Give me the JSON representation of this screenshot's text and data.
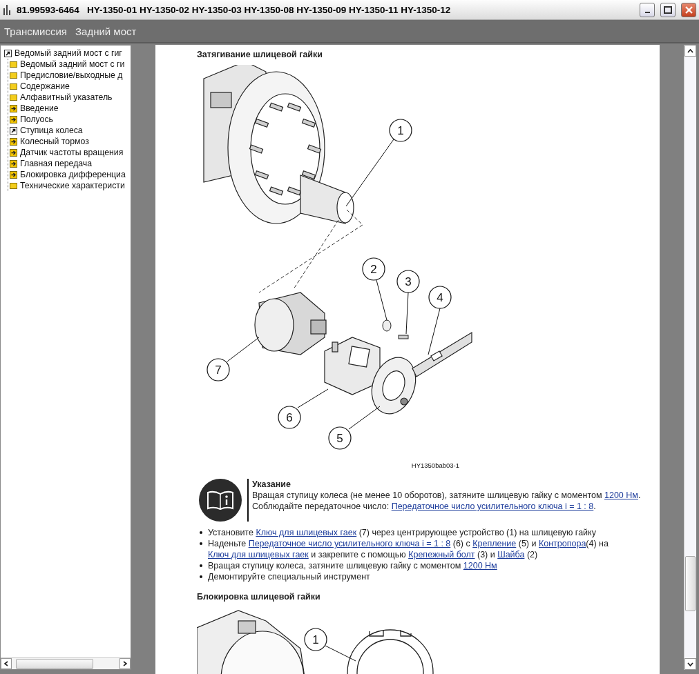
{
  "window": {
    "title": "81.99593-6464   HY-1350-01 HY-1350-02 HY-1350-03 HY-1350-08 HY-1350-09 HY-1350-11 HY-1350-12"
  },
  "menu": [
    {
      "label": "Трансмиссия"
    },
    {
      "label": "Задний мост"
    }
  ],
  "toc": {
    "items": [
      {
        "label": "Ведомый задний мост с гиг",
        "kind": "open",
        "expanded": true,
        "children": [
          {
            "label": "Ведомый задний мост с ги",
            "kind": "page"
          },
          {
            "label": "Предисловие/выходные д",
            "kind": "page"
          },
          {
            "label": "Содержание",
            "kind": "page"
          },
          {
            "label": "Алфавитный указатель",
            "kind": "page"
          },
          {
            "label": "Введение",
            "kind": "chapter"
          },
          {
            "label": "Полуось",
            "kind": "chapter"
          },
          {
            "label": "Ступица колеса",
            "kind": "open"
          },
          {
            "label": "Колесный тормоз",
            "kind": "chapter"
          },
          {
            "label": "Датчик частоты вращения",
            "kind": "chapter"
          },
          {
            "label": "Главная передача",
            "kind": "chapter"
          },
          {
            "label": "Блокировка дифференциа",
            "kind": "chapter"
          },
          {
            "label": "Технические характеристи",
            "kind": "page"
          }
        ]
      }
    ]
  },
  "document": {
    "sections": [
      {
        "heading": "Затягивание шлицевой гайки",
        "figure": {
          "kind": "exploded",
          "callouts": [
            "1",
            "2",
            "3",
            "4",
            "5",
            "6",
            "7"
          ],
          "caption": "HY1350bab03-1"
        },
        "note": {
          "title": "Указание",
          "paragraphs": [
            [
              {
                "text": "Вращая ступицу колеса (не менее 10 оборотов), затяните шлицевую гайку с моментом "
              },
              {
                "text": "1200 Нм",
                "link": true
              },
              {
                "text": "."
              }
            ],
            [
              {
                "text": "Соблюдайте передаточное число: "
              },
              {
                "text": "Передаточное число усилительного ключа i = 1 : 8",
                "link": true
              },
              {
                "text": "."
              }
            ]
          ]
        },
        "steps": [
          [
            {
              "text": "Установите "
            },
            {
              "text": "Ключ для шлицевых гаек",
              "link": true
            },
            {
              "text": " (7) через центрирующее устройство (1) на шлицевую гайку"
            }
          ],
          [
            {
              "text": "Наденьте "
            },
            {
              "text": "Передаточное число усилительного ключа i = 1 : 8",
              "link": true
            },
            {
              "text": " (6) с "
            },
            {
              "text": "Крепление",
              "link": true
            },
            {
              "text": " (5) и "
            },
            {
              "text": "Контропора",
              "link": true
            },
            {
              "text": "(4) на "
            },
            {
              "text": "Ключ для шлицевых гаек",
              "link": true
            },
            {
              "text": " и закрепите с помощью "
            },
            {
              "text": "Крепежный болт",
              "link": true
            },
            {
              "text": " (3) и "
            },
            {
              "text": "Шайба",
              "link": true
            },
            {
              "text": " (2)"
            }
          ],
          [
            {
              "text": "Вращая ступицу колеса, затяните шлицевую гайку с моментом "
            },
            {
              "text": "1200 Нм",
              "link": true
            }
          ],
          [
            {
              "text": "Демонтируйте специальный инструмент"
            }
          ]
        ]
      },
      {
        "heading": "Блокировка шлицевой гайки",
        "figure": {
          "kind": "locking",
          "callouts": [
            "1"
          ]
        }
      }
    ]
  }
}
